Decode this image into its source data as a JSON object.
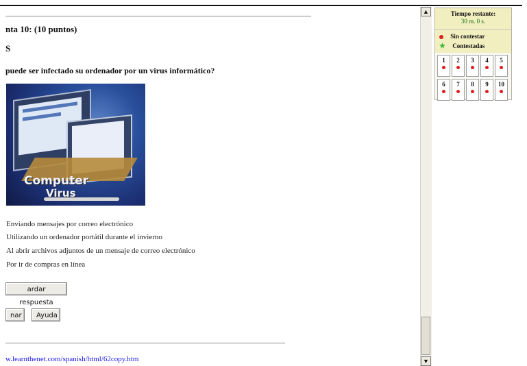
{
  "question": {
    "title": "nta 10:  (10 puntos)",
    "type_letter": "S",
    "text": "puede ser infectado su ordenador por un virus informático?",
    "image_text_line1": "Computer",
    "image_text_line2": "Virus",
    "options": [
      "Enviando mensajes por correo electrónico",
      "Utilizando un ordenador portátil durante el invierno",
      "Al abrir archivos adjuntos de un mensaje de correo electrónico",
      "Por ir de compras en línea"
    ]
  },
  "buttons": {
    "save": "ardar respuesta",
    "finish": "nar",
    "help": "Ayuda"
  },
  "footer": {
    "link": "w.learnthenet.com/spanish/html/62copy.htm"
  },
  "scrollbar": {
    "up": "▲",
    "down": "▼"
  },
  "sidebar": {
    "timer_label": "Tiempo restante:",
    "timer_value": "30 m. 0 s.",
    "legend": [
      {
        "label": "Sin contestar",
        "color": "#dd1f1f"
      },
      {
        "label": "Contestadas",
        "color": "#37b837"
      }
    ],
    "questions": [
      "1",
      "2",
      "3",
      "4",
      "5",
      "6",
      "7",
      "8",
      "9",
      "10"
    ]
  },
  "colors": {
    "link": "#1a1ae6",
    "timer": "#137113",
    "panel_bg": "#f1eebf"
  }
}
